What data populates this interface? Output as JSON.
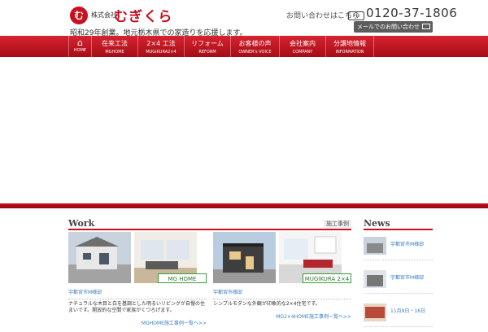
{
  "header": {
    "logo_mark": "む",
    "company_prefix": "株式会社",
    "company_name": "むぎくら",
    "tagline": "昭和29年創業。地元栃木県での家造りを応援します。",
    "contact_label": "お問い合わせはこちら",
    "freedial_icon": "freedial-icon",
    "phone": "0120-37-1806",
    "mail_button_label": "メールでのお問い合わせ"
  },
  "nav": {
    "home_label": "HOME",
    "items": [
      {
        "ja": "在来工法",
        "en": "MGHOME"
      },
      {
        "ja": "2×4 工法",
        "en": "MUGIKURA2×4"
      },
      {
        "ja": "リフォーム",
        "en": "REFORM"
      },
      {
        "ja": "お客様の声",
        "en": "OWNER's VOICE"
      },
      {
        "ja": "会社案内",
        "en": "COMPANY"
      },
      {
        "ja": "分譲地情報",
        "en": "INFORMATION"
      }
    ]
  },
  "colors": {
    "brand_red": "#c8101e",
    "link_blue": "#3a7fc0"
  },
  "work": {
    "title": "Work",
    "subtitle": "施工事例",
    "cards": [
      {
        "badge": "MG HOME",
        "title": "宇都宮市M様邸",
        "desc": "ナチュラルな木目と白を基調とした明るいリビングが自慢の住まいです。開放的な空間で家族がくつろげます。",
        "link": "MGHOME施工事例一覧へ>>"
      },
      {
        "badge": "MUGIKURA 2×4",
        "title": "宇都宮市様邸",
        "desc": "シンプルモダンな外観が印象的な2×4住宅です。",
        "link": "MG2×4HOME施工事例一覧へ>>"
      }
    ]
  },
  "news": {
    "title": "News",
    "items": [
      {
        "text": "宇都宮市M様邸"
      },
      {
        "text": "宇都宮市M様邸"
      },
      {
        "text": "11月9日・16日"
      }
    ]
  }
}
